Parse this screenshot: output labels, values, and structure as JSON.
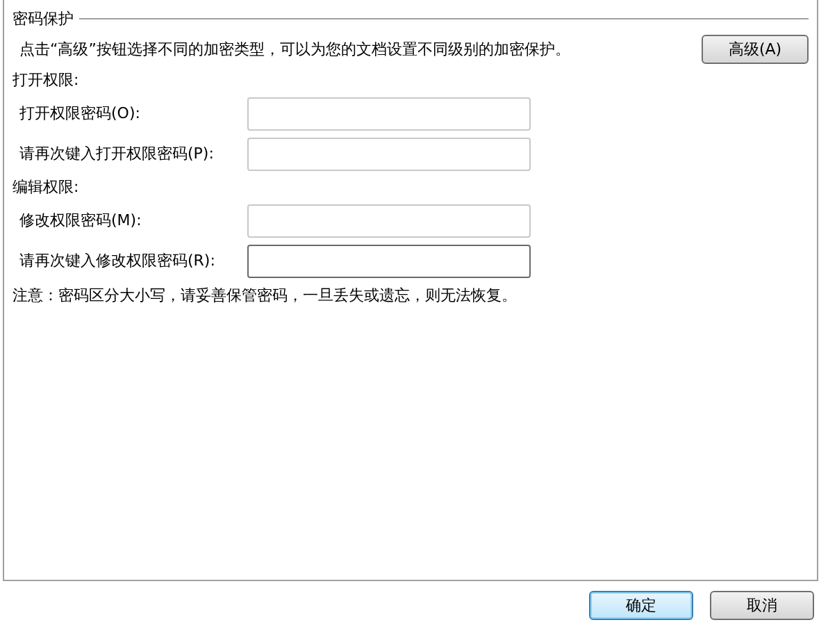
{
  "group_title": "密码保护",
  "intro": "点击“高级”按钮选择不同的加密类型，可以为您的文档设置不同级别的加密保护。",
  "advanced_button": "高级(A)",
  "sections": [
    {
      "title": "打开权限:",
      "fields": [
        {
          "label": "打开权限密码(O):",
          "focused": false
        },
        {
          "label": "请再次键入打开权限密码(P):",
          "focused": false
        }
      ]
    },
    {
      "title": "编辑权限:",
      "fields": [
        {
          "label": "修改权限密码(M):",
          "focused": false
        },
        {
          "label": "请再次键入修改权限密码(R):",
          "focused": true
        }
      ]
    }
  ],
  "note": "注意：密码区分大小写，请妥善保管密码，一旦丢失或遗忘，则无法恢复。",
  "buttons": [
    {
      "label": "确定",
      "default": true
    },
    {
      "label": "取消",
      "default": false
    }
  ]
}
